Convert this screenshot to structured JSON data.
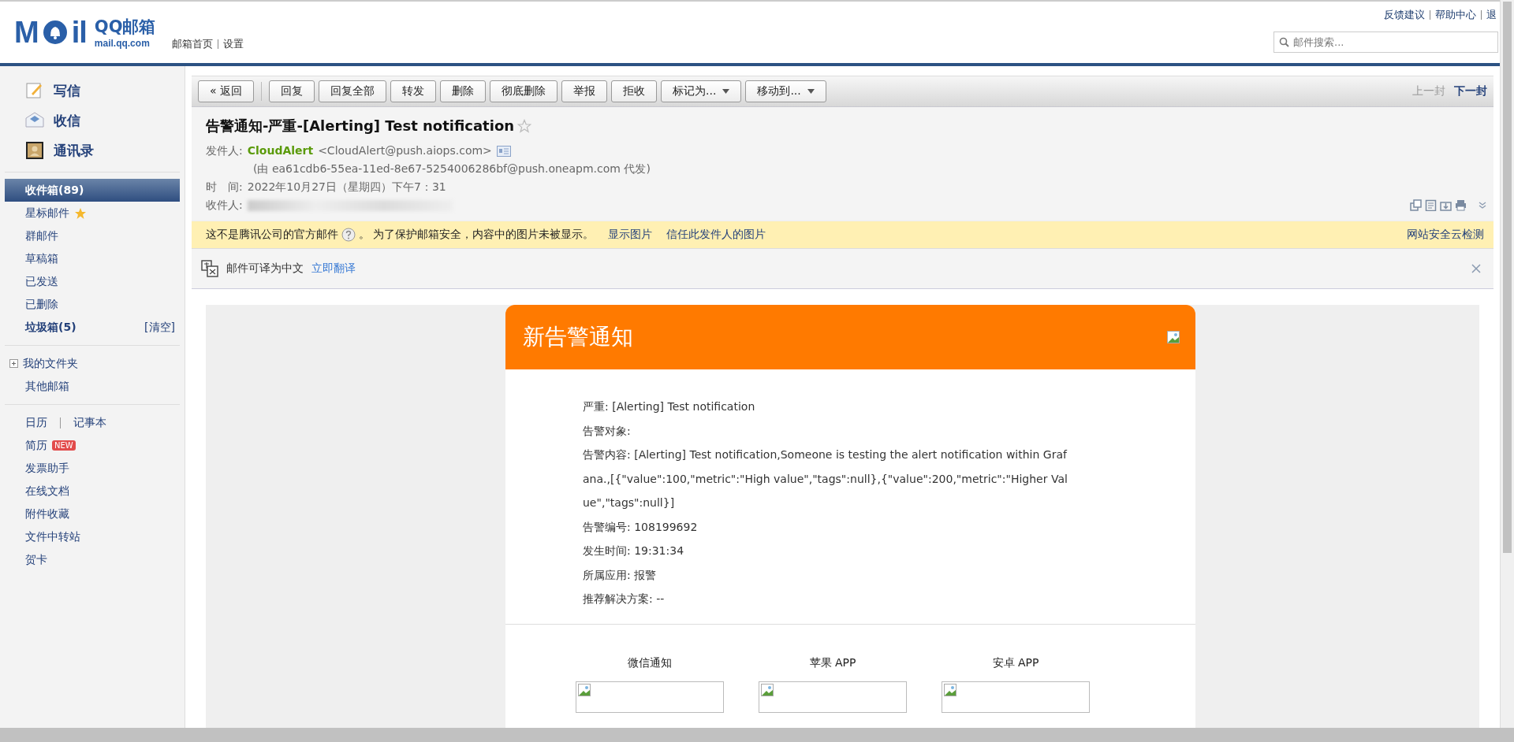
{
  "header": {
    "logo": {
      "left": "M",
      "right": "il",
      "name": "QQ邮箱",
      "domain": "mail.qq.com"
    },
    "nav_links": [
      "邮箱首页",
      "设置"
    ],
    "top_links": [
      "反馈建议",
      "帮助中心",
      "退"
    ],
    "search": {
      "placeholder": "邮件搜索..."
    }
  },
  "sidebar": {
    "actions": [
      {
        "label": "写信",
        "kind": "compose"
      },
      {
        "label": "收信",
        "kind": "receive"
      },
      {
        "label": "通讯录",
        "kind": "contacts"
      }
    ],
    "folders": [
      {
        "label": "收件箱(89)",
        "selected": true,
        "bold": true
      },
      {
        "label": "星标邮件",
        "selected": false,
        "bold": false,
        "kind": "starred"
      },
      {
        "label": "群邮件",
        "selected": false,
        "bold": false
      },
      {
        "label": "草稿箱",
        "selected": false,
        "bold": false
      },
      {
        "label": "已发送",
        "selected": false,
        "bold": false
      },
      {
        "label": "已删除",
        "selected": false,
        "bold": false
      },
      {
        "label": "垃圾箱(5)",
        "selected": false,
        "bold": true,
        "action": "[清空]"
      }
    ],
    "custom": [
      {
        "label": "我的文件夹",
        "expanded": false,
        "kind": "tree"
      },
      {
        "label": "其他邮箱"
      }
    ],
    "tools": [
      {
        "label": "日历",
        "extra": "记事本"
      },
      {
        "label": "简历",
        "badge": "NEW"
      },
      {
        "label": "发票助手"
      },
      {
        "label": "在线文档"
      },
      {
        "label": "附件收藏"
      },
      {
        "label": "文件中转站"
      },
      {
        "label": "贺卡"
      }
    ]
  },
  "toolbar": {
    "back": "« 返回",
    "buttons": [
      {
        "label": "回复",
        "dropdown": false
      },
      {
        "label": "回复全部",
        "dropdown": false
      },
      {
        "label": "转发",
        "dropdown": false
      },
      {
        "label": "删除",
        "dropdown": false
      },
      {
        "label": "彻底删除",
        "dropdown": false
      },
      {
        "label": "举报",
        "dropdown": false
      },
      {
        "label": "拒收",
        "dropdown": false
      },
      {
        "label": "标记为...",
        "dropdown": true
      },
      {
        "label": "移动到...",
        "dropdown": true
      }
    ],
    "pager": [
      {
        "label": "上一封",
        "disabled": true
      },
      {
        "label": "下一封",
        "disabled": false
      }
    ]
  },
  "mail": {
    "subject": "告警通知-严重-[Alerting] Test notification",
    "starred": false,
    "from_label": "发件人:",
    "sender_name": "CloudAlert",
    "sender_email": "<CloudAlert@push.aiops.com>",
    "proxy": "(由 ea61cdb6-55ea-11ed-8e67-5254006286bf@push.oneapm.com 代发)",
    "time_label": "时　间:",
    "time": "2022年10月27日（星期四）下午7：31",
    "to_label": "收件人:"
  },
  "notice": {
    "text": "这不是腾讯公司的官方邮件",
    "text2": "。 为了保护邮箱安全，内容中的图片未被显示。",
    "links": [
      "显示图片",
      "信任此发件人的图片"
    ],
    "right_link": "网站安全云检测"
  },
  "translate": {
    "text": "邮件可译为中文",
    "link": "立即翻译"
  },
  "card": {
    "title": "新告警通知",
    "lines": [
      "严重: [Alerting] Test notification",
      "告警对象:",
      "告警内容: [Alerting] Test notification,Someone is testing the alert notification within Grafana.,[{\"value\":100,\"metric\":\"High value\",\"tags\":null},{\"value\":200,\"metric\":\"Higher Value\",\"tags\":null}]",
      "告警编号: 108199692",
      "发生时间: 19:31:34",
      "所属应用: 报警",
      "推荐解决方案: --"
    ],
    "apps": [
      "微信通知",
      "苹果 APP",
      "安卓 APP"
    ]
  }
}
